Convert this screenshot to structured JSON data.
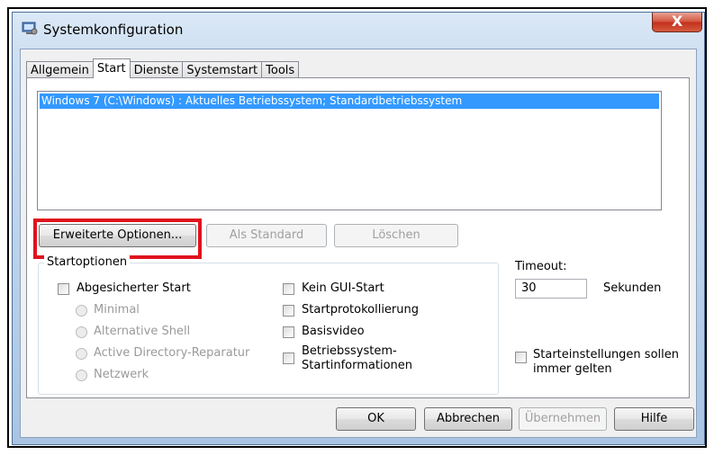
{
  "window": {
    "title": "Systemkonfiguration",
    "close_glyph": "X"
  },
  "tabs": [
    {
      "label": "Allgemein",
      "active": false
    },
    {
      "label": "Start",
      "active": true
    },
    {
      "label": "Dienste",
      "active": false
    },
    {
      "label": "Systemstart",
      "active": false
    },
    {
      "label": "Tools",
      "active": false
    }
  ],
  "boot_list": {
    "items": [
      "Windows 7 (C:\\Windows) : Aktuelles Betriebssystem; Standardbetriebssystem"
    ],
    "selected_index": 0
  },
  "boot_buttons": {
    "advanced": "Erweiterte Optionen...",
    "set_default": "Als Standard",
    "delete": "Löschen"
  },
  "boot_options": {
    "group_label": "Startoptionen",
    "safe_boot": "Abgesicherter Start",
    "minimal": "Minimal",
    "alternate_shell": "Alternative Shell",
    "ad_repair": "Active Directory-Reparatur",
    "network": "Netzwerk",
    "no_gui_boot": "Kein GUI-Start",
    "boot_log": "Startprotokollierung",
    "base_video": "Basisvideo",
    "os_boot_info_line1": "Betriebssystem-",
    "os_boot_info_line2": "Startinformationen"
  },
  "timeout": {
    "label": "Timeout:",
    "value": "30",
    "unit": "Sekunden"
  },
  "permanent": {
    "line1": "Starteinstellungen sollen",
    "line2": "immer gelten"
  },
  "footer": {
    "ok": "OK",
    "cancel": "Abbrechen",
    "apply": "Übernehmen",
    "help": "Hilfe"
  },
  "colors": {
    "selection": "#3399ff",
    "highlight_frame": "#e0131d",
    "close_button": "#c9402a"
  },
  "icons": {
    "app": "system-config-icon",
    "close": "close-icon"
  }
}
